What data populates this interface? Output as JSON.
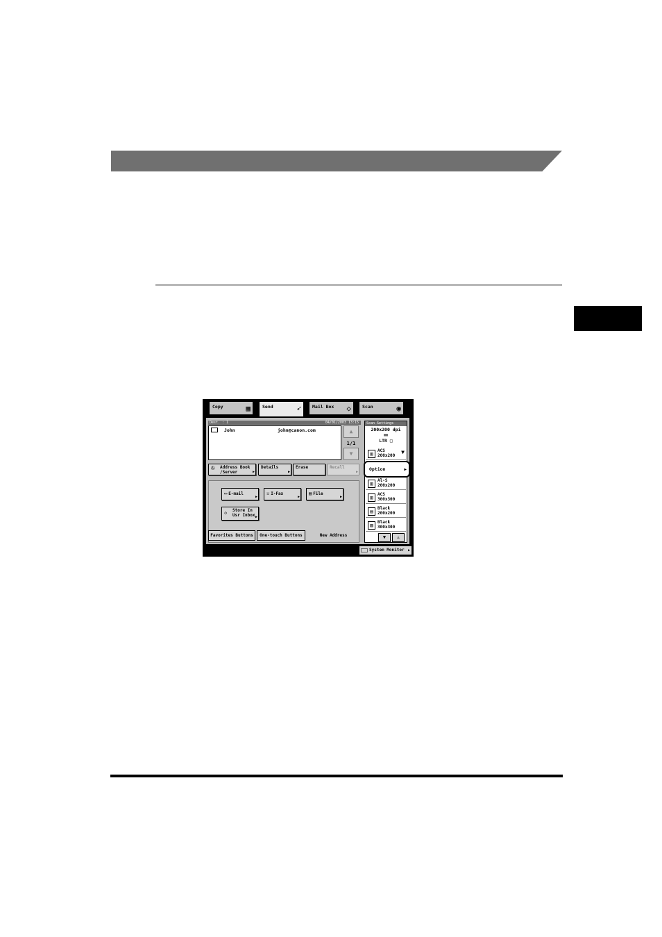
{
  "panel": {
    "tabs": [
      {
        "label": "Copy",
        "icon": "copy-icon"
      },
      {
        "label": "Send",
        "icon": "send-icon"
      },
      {
        "label": "Mail Box",
        "icon": "mailbox-icon"
      },
      {
        "label": "Scan",
        "icon": "scan-icon"
      }
    ],
    "destination": {
      "header": "Dest. :  1",
      "datetime": "04/01/2003 13:15",
      "rows": [
        {
          "name": "John",
          "email": "john@canon.com"
        }
      ],
      "page": "1/1"
    },
    "actions": {
      "address_book": "Address Book",
      "address_book_2": "/Server",
      "details": "Details",
      "erase": "Erase",
      "recall": "Recall"
    },
    "new_address": {
      "email": "E-mail",
      "ifax": "I-Fax",
      "file": "File",
      "store_1": "Store In",
      "store_2": "Usr Inbox"
    },
    "subtabs": {
      "favorites": "Favorites Buttons",
      "one_touch": "One-touch Buttons",
      "new_address": "New Address"
    },
    "scan_settings": {
      "header": "Scan Settings",
      "resolution": "200x200 dpi",
      "paper": "LTR",
      "current_mode_1": "ACS",
      "current_mode_2": "200x200",
      "option": "Option",
      "modes": [
        {
          "line1": "Al-S",
          "line2": "200x200"
        },
        {
          "line1": "ACS",
          "line2": "300x300"
        },
        {
          "line1": "Black",
          "line2": "200x200"
        },
        {
          "line1": "Black",
          "line2": "300x300"
        }
      ]
    },
    "system_monitor": "System Monitor"
  }
}
